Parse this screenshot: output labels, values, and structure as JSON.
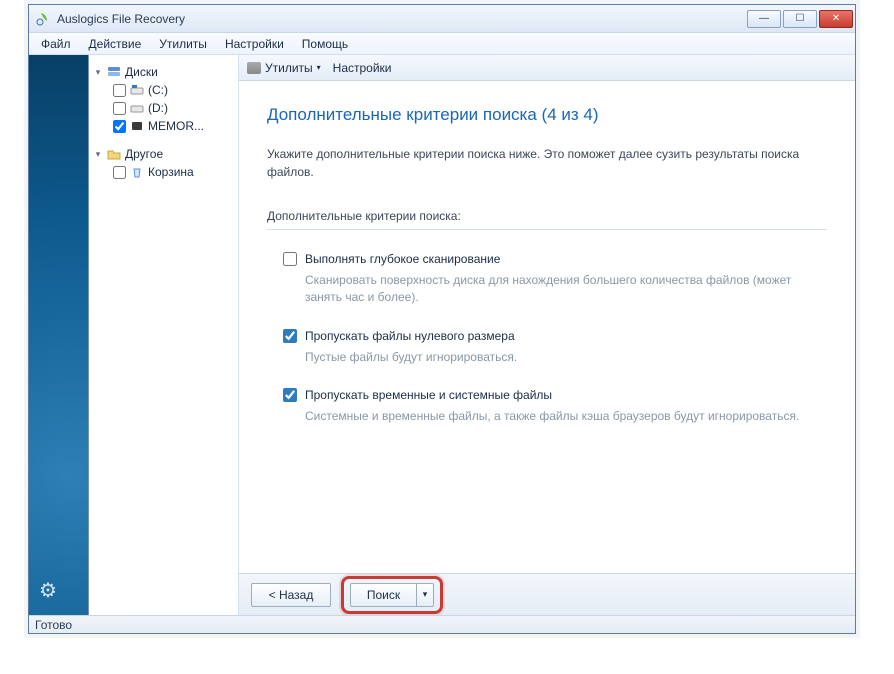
{
  "window": {
    "title": "Auslogics File Recovery"
  },
  "menu": {
    "file": "Файл",
    "action": "Действие",
    "utilities": "Утилиты",
    "settings": "Настройки",
    "help": "Помощь"
  },
  "toolbar": {
    "utilities": "Утилиты",
    "settings": "Настройки"
  },
  "tree": {
    "disks_label": "Диски",
    "items": [
      {
        "label": "(C:)",
        "checked": false
      },
      {
        "label": "(D:)",
        "checked": false
      },
      {
        "label": "MEMOR...",
        "checked": true
      }
    ],
    "other_label": "Другое",
    "other_items": [
      {
        "label": "Корзина",
        "checked": false
      }
    ]
  },
  "page": {
    "title": "Дополнительные критерии поиска (4 из 4)",
    "desc": "Укажите дополнительные критерии поиска ниже. Это поможет далее сузить результаты поиска файлов.",
    "section": "Дополнительные критерии поиска:"
  },
  "options": [
    {
      "label": "Выполнять глубокое сканирование",
      "hint": "Сканировать поверхность диска для нахождения большего количества файлов (может занять час и более).",
      "checked": false
    },
    {
      "label": "Пропускать файлы нулевого размера",
      "hint": "Пустые файлы будут игнорироваться.",
      "checked": true
    },
    {
      "label": "Пропускать временные и системные файлы",
      "hint": "Системные и временные файлы, а также файлы кэша браузеров будут игнорироваться.",
      "checked": true
    }
  ],
  "buttons": {
    "back": "< Назад",
    "search": "Поиск"
  },
  "status": "Готово"
}
